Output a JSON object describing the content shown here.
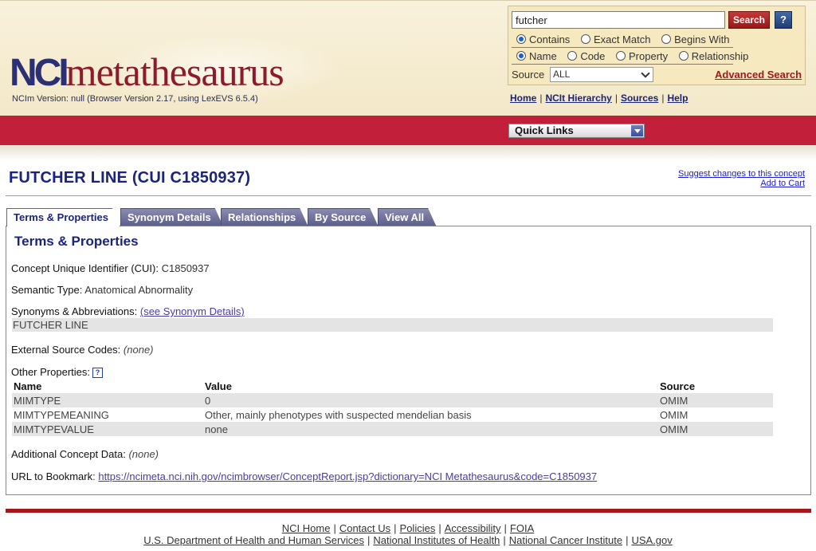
{
  "header": {
    "logo_prefix": "NCI",
    "logo_suffix": "metathesaurus",
    "version": "NCIm Version: null (Browser Version 2.17, using LexEVS 6.5.4)"
  },
  "search": {
    "value": "futcher",
    "button_label": "Search",
    "help_label": "?",
    "match_options": [
      {
        "label": "Contains",
        "selected": true
      },
      {
        "label": "Exact Match",
        "selected": false
      },
      {
        "label": "Begins With",
        "selected": false
      }
    ],
    "target_options": [
      {
        "label": "Name",
        "selected": true
      },
      {
        "label": "Code",
        "selected": false
      },
      {
        "label": "Property",
        "selected": false
      },
      {
        "label": "Relationship",
        "selected": false
      }
    ],
    "source_label": "Source",
    "source_value": "ALL",
    "advanced_label": "Advanced Search"
  },
  "top_links": [
    "Home",
    "NCIt Hierarchy",
    "Sources",
    "Help"
  ],
  "quick_links_label": "Quick Links",
  "concept": {
    "title": "FUTCHER LINE (CUI C1850937)",
    "suggest_label": "Suggest changes to this concept",
    "cart_label": "Add to Cart"
  },
  "tabs": [
    "Terms & Properties",
    "Synonym Details",
    "Relationships",
    "By Source",
    "View All"
  ],
  "panel": {
    "title": "Terms & Properties",
    "cui_label": "Concept Unique Identifier (CUI):",
    "cui_value": "C1850937",
    "semantic_label": "Semantic Type:",
    "semantic_value": "Anatomical Abnormality",
    "synonyms_label": "Synonyms & Abbreviations:",
    "synonyms_link": "(see Synonym Details)",
    "synonym_row": "FUTCHER LINE",
    "external_label": "External Source Codes:",
    "external_value": "(none)",
    "other_label": "Other Properties:",
    "props_headers": [
      "Name",
      "Value",
      "Source"
    ],
    "props_rows": [
      [
        "MIMTYPE",
        "0",
        "OMIM"
      ],
      [
        "MIMTYPEMEANING",
        "Other, mainly phenotypes with suspected mendelian basis",
        "OMIM"
      ],
      [
        "MIMTYPEVALUE",
        "none",
        "OMIM"
      ]
    ],
    "additional_label": "Additional Concept Data:",
    "additional_value": "(none)",
    "url_label": "URL to Bookmark",
    "url_value": "https://ncimeta.nci.nih.gov/ncimbrowser/ConceptReport.jsp?dictionary=NCI Metathesaurus&code=C1850937"
  },
  "footer": {
    "row1": [
      "NCI Home",
      "Contact Us",
      "Policies",
      "Accessibility",
      "FOIA"
    ],
    "row2": [
      "U.S. Department of Health and Human Services",
      "National Institutes of Health",
      "National Cancer Institute",
      "USA.gov"
    ]
  },
  "colors": {
    "brand_red": "#c2203a",
    "brand_navy": "#1a237e",
    "header_bg": "#f6e9c0"
  }
}
